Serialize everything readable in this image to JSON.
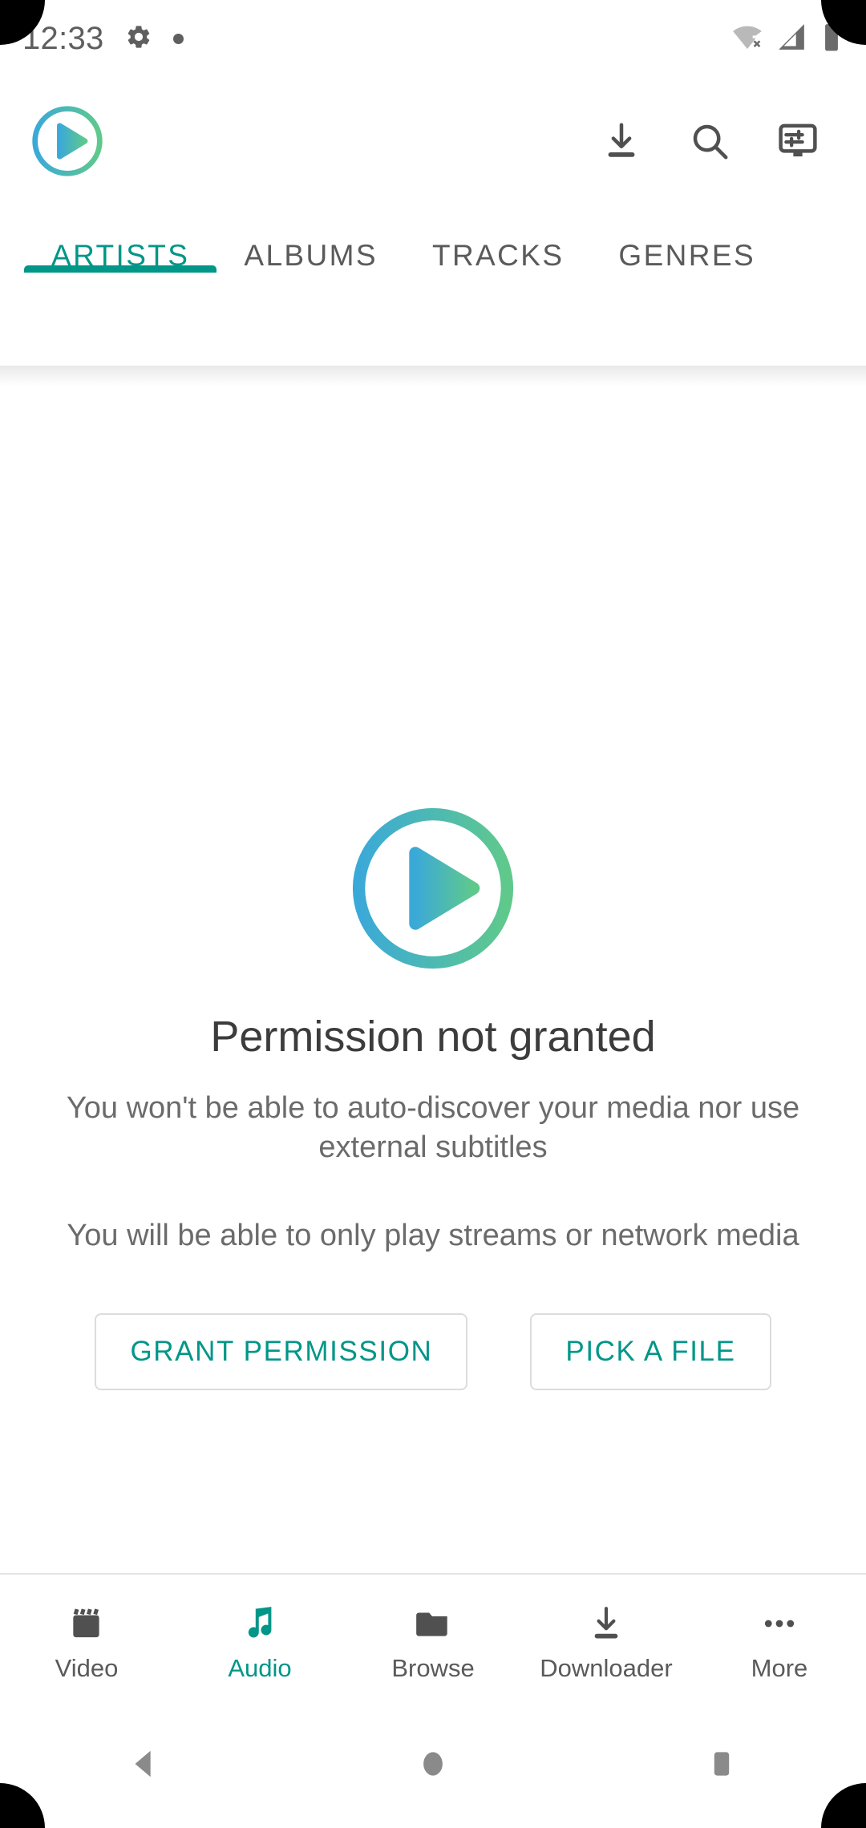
{
  "status_bar": {
    "time": "12:33",
    "icons": [
      "gear-icon",
      "notification-dot",
      "wifi-no-connection-icon",
      "cell-signal-icon",
      "battery-full-icon"
    ]
  },
  "app_bar": {
    "logo": "vlc-play-circle-logo",
    "actions": [
      {
        "name": "download-icon",
        "label": "Download"
      },
      {
        "name": "search-icon",
        "label": "Search"
      },
      {
        "name": "display-settings-icon",
        "label": "Display settings"
      }
    ]
  },
  "tabs": [
    {
      "label": "ARTISTS",
      "active": true
    },
    {
      "label": "ALBUMS",
      "active": false
    },
    {
      "label": "TRACKS",
      "active": false
    },
    {
      "label": "GENRES",
      "active": false
    }
  ],
  "empty_state": {
    "logo": "vlc-play-circle-logo",
    "title": "Permission not granted",
    "description_1": "You won't be able to auto-discover your media nor use external subtitles",
    "description_2": "You will be able to only play streams or network media",
    "primary_button": "GRANT PERMISSION",
    "secondary_button": "PICK A FILE"
  },
  "bottom_nav": [
    {
      "label": "Video",
      "icon": "movie-clapper-icon",
      "active": false
    },
    {
      "label": "Audio",
      "icon": "music-note-icon",
      "active": true
    },
    {
      "label": "Browse",
      "icon": "folder-icon",
      "active": false
    },
    {
      "label": "Downloader",
      "icon": "download-icon",
      "active": false
    },
    {
      "label": "More",
      "icon": "more-horizontal-icon",
      "active": false
    }
  ],
  "system_nav": [
    {
      "name": "back-button",
      "icon": "triangle-back-icon"
    },
    {
      "name": "home-button",
      "icon": "circle-home-icon"
    },
    {
      "name": "recents-button",
      "icon": "square-recents-icon"
    }
  ],
  "colors": {
    "accent_teal": "#009688",
    "logo_gradient_start": "#3BA9D8",
    "logo_gradient_end": "#5FC98C",
    "text_primary": "#3c3c3c",
    "text_secondary": "#6b6b6b",
    "icon_gray": "#505050"
  }
}
